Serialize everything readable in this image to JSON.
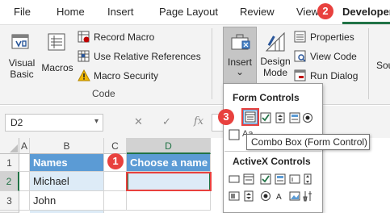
{
  "tabs": [
    "File",
    "Home",
    "Insert",
    "Page Layout",
    "Review",
    "View",
    "Developer"
  ],
  "ribbon": {
    "visual_basic": [
      "Visual",
      "Basic"
    ],
    "macros": "Macros",
    "record_macro": "Record Macro",
    "relative_refs": "Use Relative References",
    "macro_security": "Macro Security",
    "code_group": "Code",
    "insert": "Insert",
    "insert_caret": "⌄",
    "design_mode": [
      "Design",
      "Mode"
    ],
    "properties": "Properties",
    "view_code": "View Code",
    "run_dialog": "Run Dialog",
    "source_partial": "Sou"
  },
  "formula_bar": {
    "name_box": "D2",
    "name_box_caret": "▾",
    "fx": "fx",
    "cancel": "✕",
    "enter": "✓"
  },
  "grid": {
    "columns": [
      "A",
      "B",
      "C",
      "D"
    ],
    "rows": [
      "1",
      "2",
      "3"
    ],
    "cells": {
      "B1": "Names",
      "D1": "Choose a name",
      "B2": "Michael",
      "B3": "John"
    }
  },
  "dropdown": {
    "form_controls": "Form Controls",
    "activex_controls": "ActiveX Controls",
    "tooltip": "Combo Box (Form Control)",
    "stray_label": "Aa"
  },
  "badges": [
    "1",
    "2",
    "3"
  ],
  "colors": {
    "accent_green": "#217346",
    "badge_red": "#e8413e",
    "table_header_blue": "#5b9bd5",
    "band_blue": "#ddebf7"
  }
}
